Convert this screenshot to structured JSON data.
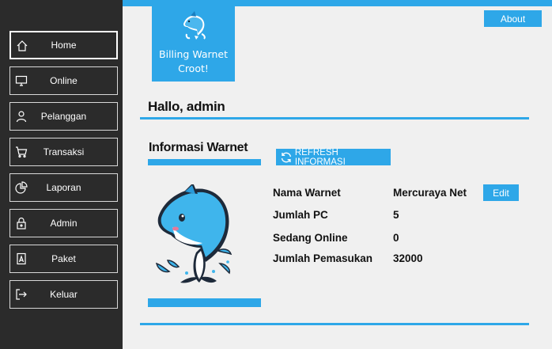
{
  "sidebar": {
    "items": [
      {
        "label": "Home",
        "icon": "home-icon"
      },
      {
        "label": "Online",
        "icon": "monitor-icon"
      },
      {
        "label": "Pelanggan",
        "icon": "user-icon"
      },
      {
        "label": "Transaksi",
        "icon": "cart-icon"
      },
      {
        "label": "Laporan",
        "icon": "pie-chart-icon"
      },
      {
        "label": "Admin",
        "icon": "lock-icon"
      },
      {
        "label": "Paket",
        "icon": "package-icon"
      },
      {
        "label": "Keluar",
        "icon": "logout-icon"
      }
    ],
    "active": "Home"
  },
  "brand": {
    "line1": "Billing Warnet",
    "line2": "Croot!"
  },
  "header": {
    "about_label": "About"
  },
  "greeting": "Hallo, admin",
  "info": {
    "title": "Informasi Warnet",
    "refresh_label": "REFRESH INFORMASI",
    "edit_label": "Edit",
    "rows": [
      {
        "label": "Nama Warnet",
        "value": "Mercuraya Net"
      },
      {
        "label": "Jumlah PC",
        "value": "5"
      },
      {
        "label": "Sedang Online",
        "value": "0"
      },
      {
        "label": "Jumlah Pemasukan",
        "value": "32000"
      }
    ]
  },
  "colors": {
    "accent": "#2ea7e8",
    "sidebar": "#2b2b2b",
    "background": "#f0f0f0"
  }
}
